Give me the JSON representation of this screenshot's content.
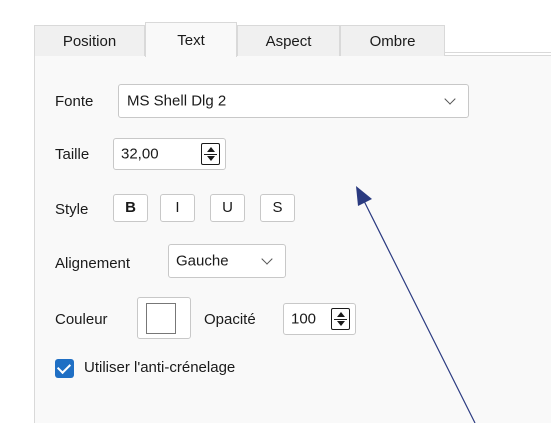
{
  "tabs": [
    {
      "label": "Position",
      "active": false
    },
    {
      "label": "Text",
      "active": true
    },
    {
      "label": "Aspect",
      "active": false
    },
    {
      "label": "Ombre",
      "active": false
    }
  ],
  "font": {
    "label": "Fonte",
    "value": "MS Shell Dlg 2"
  },
  "size": {
    "label": "Taille",
    "value": "32,00"
  },
  "style": {
    "label": "Style",
    "bold": "B",
    "italic": "I",
    "underline": "U",
    "strike": "S"
  },
  "alignment": {
    "label": "Alignement",
    "value": "Gauche"
  },
  "color": {
    "label": "Couleur",
    "swatch": "#ffffff",
    "opacity_label": "Opacité",
    "opacity_value": "100"
  },
  "antialias": {
    "label": "Utiliser l'anti-crénelage",
    "checked": true,
    "accent": "#1f6fc4"
  }
}
